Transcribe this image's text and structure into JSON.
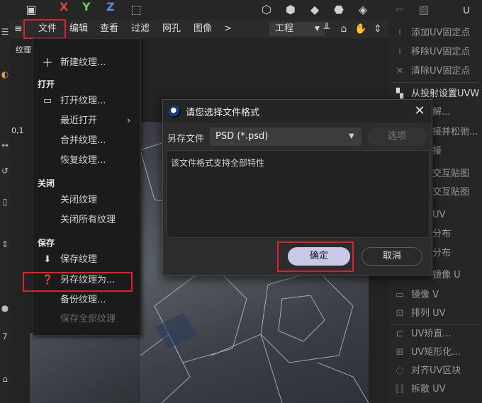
{
  "colors": {
    "highlight": "#e0202a",
    "axis_x": "#e04040",
    "axis_y": "#60d060",
    "axis_z": "#5a8ae8",
    "ok_button": "#c8c8e8"
  },
  "toolbar": {
    "axis_x": "X",
    "axis_y": "Y",
    "axis_z": "Z"
  },
  "menubar": {
    "items": [
      "文件",
      "编辑",
      "查看",
      "过滤",
      "网孔",
      "图像"
    ],
    "more": ">",
    "mode_value": "工程"
  },
  "viewport": {
    "tab_label": "纹理",
    "coord_readout": "0,1"
  },
  "file_menu": {
    "new_texture": "新建纹理...",
    "section_open": "打开",
    "open_texture": "打开纹理...",
    "recent": "最近打开",
    "merge": "合并纹理...",
    "restore": "恢复纹理...",
    "section_close": "关闭",
    "close_texture": "关闭纹理",
    "close_all": "关闭所有纹理",
    "section_save": "保存",
    "save_texture": "保存纹理",
    "save_as": "另存纹理为...",
    "backup": "备份纹理...",
    "save_all": "保存全部纹理"
  },
  "right_panel": {
    "items": [
      {
        "icon": "pin-icon",
        "label": "添加UV固定点"
      },
      {
        "icon": "pin-remove-icon",
        "label": "移除UV固定点"
      },
      {
        "icon": "x-icon",
        "label": "清除UV固定点"
      },
      {
        "icon": "checker-icon",
        "label": "从投射设置UVW"
      },
      {
        "icon": "blank-icon",
        "label": "解..."
      },
      {
        "icon": "blank-icon",
        "label": "接并松弛..."
      },
      {
        "icon": "blank-icon",
        "label": "接"
      },
      {
        "icon": "blank-icon",
        "label": "交互贴图"
      },
      {
        "icon": "blank-icon",
        "label": "交互贴图"
      },
      {
        "icon": "blank-icon",
        "label": "UV"
      },
      {
        "icon": "blank-icon",
        "label": "分布"
      },
      {
        "icon": "blank-icon",
        "label": "分布"
      },
      {
        "icon": "blank-icon",
        "label": "镜像 U"
      },
      {
        "icon": "mirror-v-icon",
        "label": "镜像 V"
      },
      {
        "icon": "arrange-icon",
        "label": "排列 UV"
      },
      {
        "icon": "straighten-icon",
        "label": "UV矫直..."
      },
      {
        "icon": "grid-icon",
        "label": "UV矩形化..."
      },
      {
        "icon": "align-icon",
        "label": "对齐UV区块"
      },
      {
        "icon": "scatter-icon",
        "label": "拆散 UV"
      }
    ]
  },
  "dialog": {
    "title": "请您选择文件格式",
    "format_label": "另存文件",
    "format_value": "PSD (*.psd)",
    "options_label": "选项",
    "info_text": "该文件格式支持全部特性",
    "ok_label": "确定",
    "cancel_label": "取消"
  }
}
